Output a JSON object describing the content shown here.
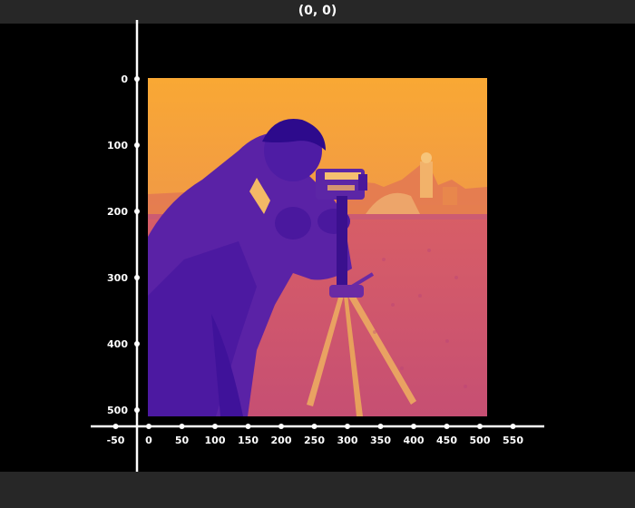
{
  "viewer": {
    "title": "(0, 0)",
    "colormap": "plasma",
    "colors": {
      "background": "#000000",
      "chrome": "#272727",
      "axis": "#ffffff"
    },
    "image": {
      "name": "cameraman",
      "width": 512,
      "height": 512
    }
  },
  "axes": {
    "x_ticks": [
      "-50",
      "0",
      "50",
      "100",
      "150",
      "200",
      "250",
      "300",
      "350",
      "400",
      "450",
      "500",
      "550"
    ],
    "y_ticks": [
      "0",
      "100",
      "200",
      "300",
      "400",
      "500"
    ]
  }
}
